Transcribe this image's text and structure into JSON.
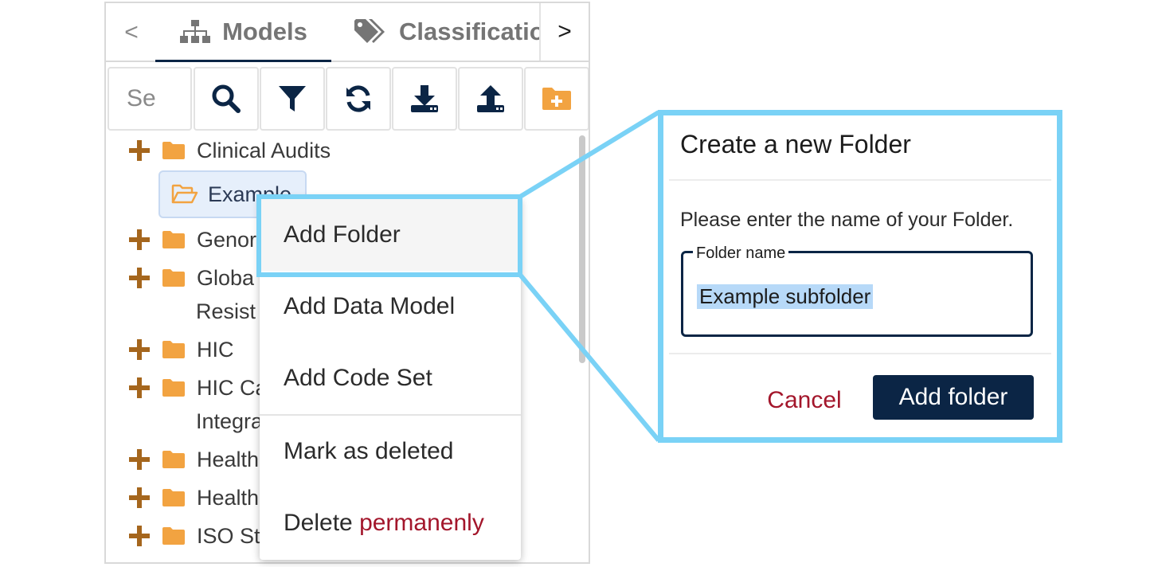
{
  "tabs": {
    "prev_glyph": "<",
    "next_glyph": ">",
    "items": [
      {
        "label": "Models",
        "icon": "sitemap-icon",
        "active": true
      },
      {
        "label": "Classificatio",
        "icon": "tags-icon",
        "active": false
      }
    ]
  },
  "toolbar": {
    "search_placeholder": "Se",
    "buttons": [
      "search-icon",
      "filter-icon",
      "refresh-icon",
      "download-icon",
      "upload-icon",
      "add-folder-icon"
    ]
  },
  "tree": {
    "items": [
      {
        "label": "Clinical Audits"
      },
      {
        "label": "Example",
        "selected": true
      },
      {
        "label": "Genor"
      },
      {
        "label": "Globa",
        "continuation": "Resist"
      },
      {
        "label": "HIC"
      },
      {
        "label": "HIC Ca",
        "continuation": "Integra"
      },
      {
        "label": "Health"
      },
      {
        "label": "Health"
      },
      {
        "label": "ISO St"
      }
    ]
  },
  "context_menu": {
    "items": [
      {
        "label": "Add Folder"
      },
      {
        "label": "Add Data Model"
      },
      {
        "label": "Add Code Set"
      },
      {
        "label": "Mark as deleted"
      }
    ],
    "delete_prefix": "Delete",
    "delete_emphasis": "permanenly"
  },
  "dialog": {
    "title": "Create a new Folder",
    "message": "Please enter the name of your Folder.",
    "field_label": "Folder name",
    "field_value": "Example subfolder",
    "cancel_label": "Cancel",
    "submit_label": "Add folder"
  },
  "colors": {
    "accent": "#0b2545",
    "folder": "#f2a341",
    "plus": "#a5661d",
    "danger": "#a3162b",
    "callout": "#7ad2f6"
  }
}
